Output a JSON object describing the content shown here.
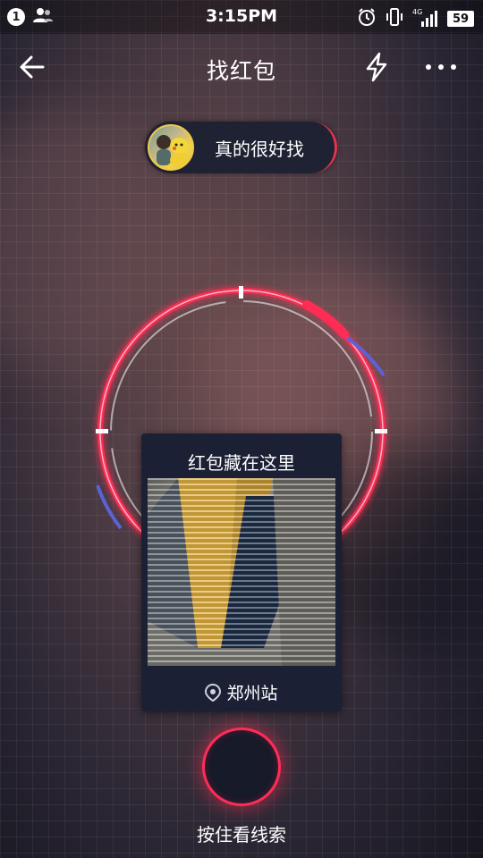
{
  "status_bar": {
    "notification_count": "1",
    "time": "3:15PM",
    "network_type": "4G",
    "battery": "59"
  },
  "nav": {
    "title": "找红包"
  },
  "user": {
    "hint": "真的很好找"
  },
  "clue_card": {
    "title": "红包藏在这里",
    "location": "郑州站"
  },
  "hold_button": {
    "label": "按住看线索"
  },
  "colors": {
    "accent_red": "#ff2d55",
    "accent_blue": "#5a63d6",
    "card_bg": "#1b2034"
  }
}
